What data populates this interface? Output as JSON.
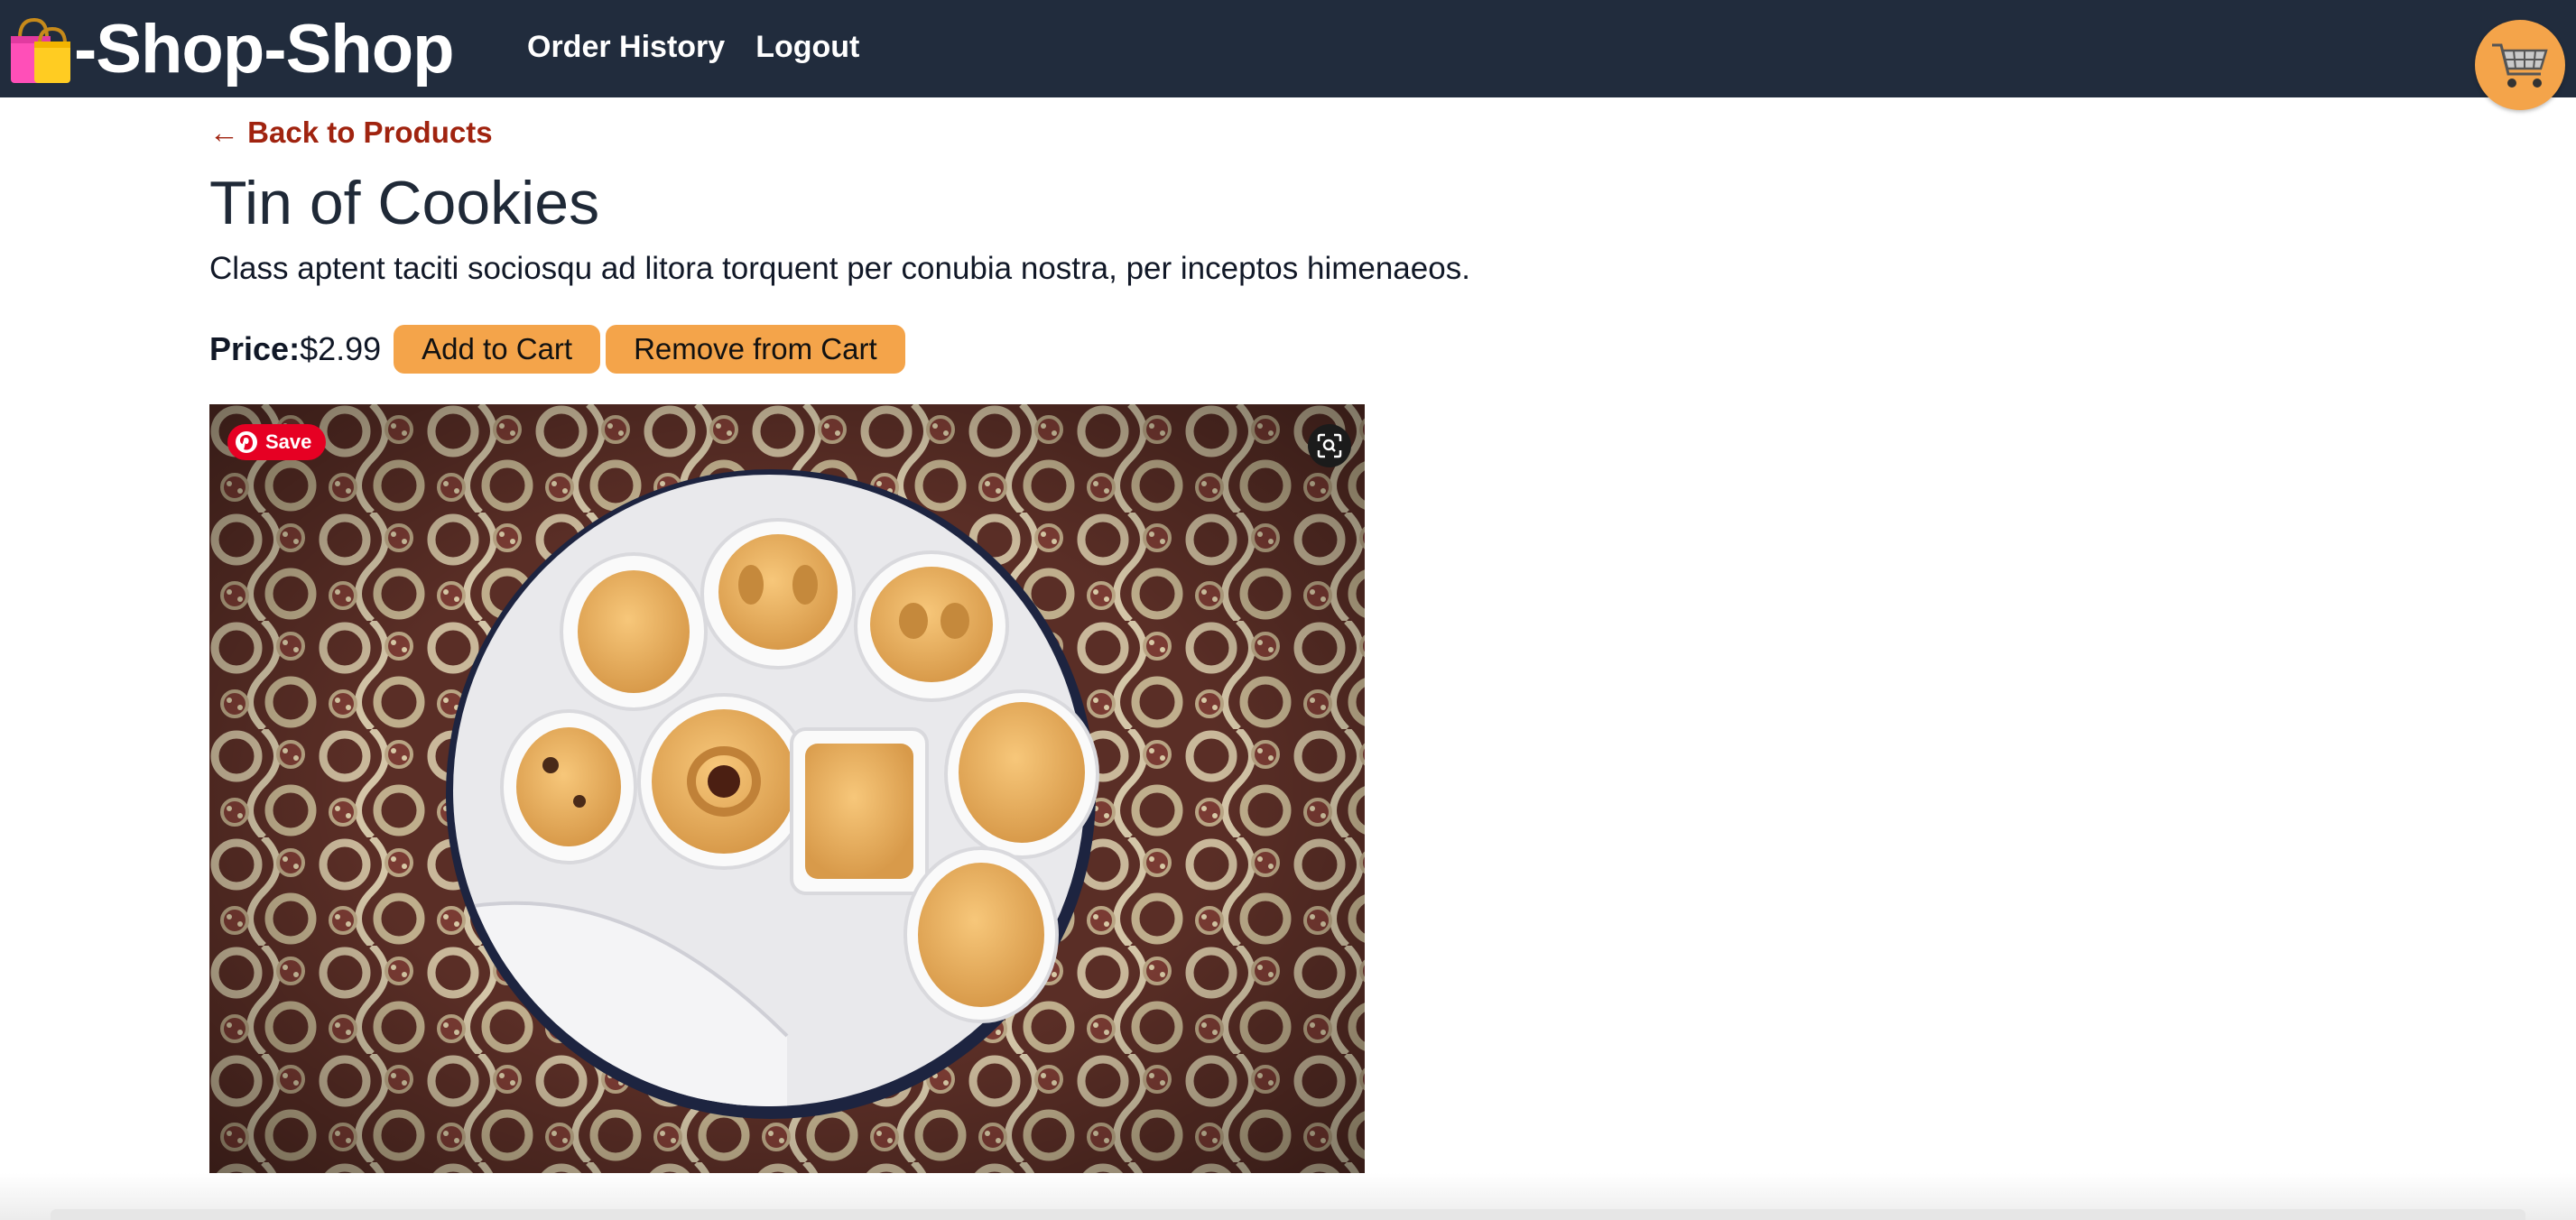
{
  "header": {
    "brand": "-Shop-Shop",
    "brand_icon": "shopping-bags-icon",
    "nav": [
      {
        "label": "Order History"
      },
      {
        "label": "Logout"
      }
    ],
    "cart_icon": "shopping-cart-icon"
  },
  "product": {
    "back_link": "← Back to Products",
    "name": "Tin of Cookies",
    "description": "Class aptent taciti sociosqu ad litora torquent per conubia nostra, per inceptos himenaeos.",
    "price_label": "Price:",
    "price": "$2.99",
    "add_button": "Add to Cart",
    "remove_button": "Remove from Cart"
  },
  "image_overlay": {
    "pin_save": "Save",
    "lens_icon": "visual-search-icon"
  },
  "colors": {
    "header_bg": "#212c3d",
    "accent": "#f4a44a",
    "back_link": "#a0230f",
    "pinterest": "#e60023"
  }
}
